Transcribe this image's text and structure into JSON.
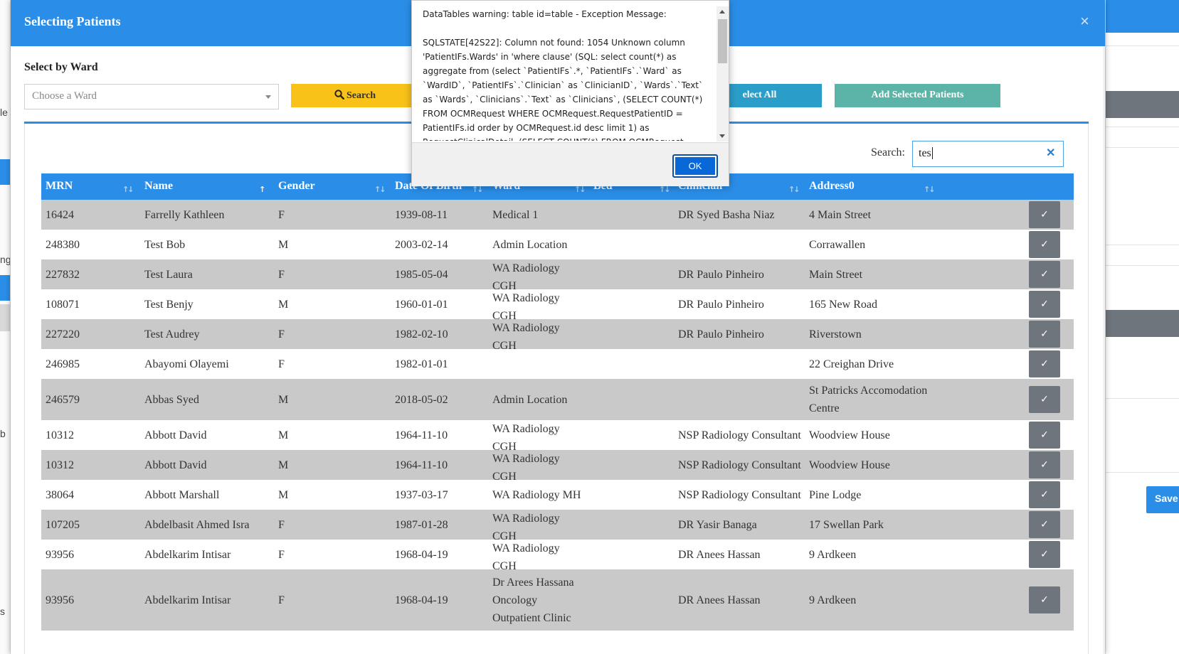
{
  "background": {
    "left_fragments": [
      "le",
      "ng",
      "b",
      "s"
    ],
    "save_label": "Save"
  },
  "modal": {
    "title": "Selecting Patients",
    "close_glyph": "×",
    "ward_label": "Select by Ward",
    "ward_placeholder": "Choose a Ward",
    "search_button": "Search",
    "select_all_button": "elect All",
    "add_selected_button": "Add Selected Patients",
    "search_label": "Search:",
    "search_value": "tes",
    "clear_glyph": "✕"
  },
  "table": {
    "columns": [
      "MRN",
      "Name",
      "Gender",
      "Date Of Birth",
      "Ward",
      "Bed",
      "Clinician",
      "Address0"
    ],
    "rows": [
      {
        "mrn": "16424",
        "name": "Farrelly Kathleen",
        "gender": "F",
        "dob": "1939-08-11",
        "ward": "Medical 1",
        "clinician": "DR Syed Basha Niaz",
        "address": "4 Main Street"
      },
      {
        "mrn": "248380",
        "name": "Test Bob",
        "gender": "M",
        "dob": "2003-02-14",
        "ward": "Admin Location",
        "clinician": "",
        "address": "Corrawallen"
      },
      {
        "mrn": "227832",
        "name": "Test Laura",
        "gender": "F",
        "dob": "1985-05-04",
        "ward": "WA Radiology CGH",
        "clinician": "DR Paulo Pinheiro",
        "address": "Main Street"
      },
      {
        "mrn": "108071",
        "name": "Test Benjy",
        "gender": "M",
        "dob": "1960-01-01",
        "ward": "WA Radiology CGH",
        "clinician": "DR Paulo Pinheiro",
        "address": "165 New Road"
      },
      {
        "mrn": "227220",
        "name": "Test Audrey",
        "gender": "F",
        "dob": "1982-02-10",
        "ward": "WA Radiology CGH",
        "clinician": "DR Paulo Pinheiro",
        "address": "Riverstown"
      },
      {
        "mrn": "246985",
        "name": "Abayomi Olayemi",
        "gender": "F",
        "dob": "1982-01-01",
        "ward": "",
        "clinician": "",
        "address": "22 Creighan Drive"
      },
      {
        "mrn": "246579",
        "name": "Abbas Syed",
        "gender": "M",
        "dob": "2018-05-02",
        "ward": "Admin Location",
        "clinician": "",
        "address": "St Patricks Accomodation Centre"
      },
      {
        "mrn": "10312",
        "name": "Abbott David",
        "gender": "M",
        "dob": "1964-11-10",
        "ward": "WA Radiology CGH",
        "clinician": "NSP Radiology Consultant",
        "address": "Woodview House"
      },
      {
        "mrn": "10312",
        "name": "Abbott David",
        "gender": "M",
        "dob": "1964-11-10",
        "ward": "WA Radiology CGH",
        "clinician": "NSP Radiology Consultant",
        "address": "Woodview House"
      },
      {
        "mrn": "38064",
        "name": "Abbott Marshall",
        "gender": "M",
        "dob": "1937-03-17",
        "ward": "WA Radiology MH",
        "clinician": "NSP Radiology Consultant",
        "address": "Pine Lodge"
      },
      {
        "mrn": "107205",
        "name": "Abdelbasit Ahmed Isra",
        "gender": "F",
        "dob": "1987-01-28",
        "ward": "WA Radiology CGH",
        "clinician": "DR Yasir Banaga",
        "address": "17 Swellan Park"
      },
      {
        "mrn": "93956",
        "name": "Abdelkarim Intisar",
        "gender": "F",
        "dob": "1968-04-19",
        "ward": "WA Radiology CGH",
        "clinician": "DR Anees Hassan",
        "address": "9 Ardkeen"
      },
      {
        "mrn": "93956",
        "name": "Abdelkarim Intisar",
        "gender": "F",
        "dob": "1968-04-19",
        "ward": "Dr Arees Hassana Oncology Outpatient Clinic",
        "clinician": "DR Anees Hassan",
        "address": "9 Ardkeen"
      }
    ],
    "select_glyph": "✓"
  },
  "alert": {
    "message": "DataTables warning: table id=table - Exception Message:\n\nSQLSTATE[42S22]: Column not found: 1054 Unknown column 'PatientIFs.Wards' in 'where clause' (SQL: select count(*) as aggregate from (select `PatientIFs`.*, `PatientIFs`.`Ward` as `WardID`, `PatientIFs`.`Clinician` as `ClinicianID`, `Wards`.`Text` as `Wards`, `Clinicians`.`Text` as `Clinicians`, (SELECT COUNT(*) FROM OCMRequest WHERE OCMRequest.RequestPatientID = PatientIFs.id order by OCMRequest.id desc limit 1) as RequestClinicalDetail, (SELECT COUNT(*) FROM OCMRequest WHERE",
    "ok_label": "OK"
  },
  "colors": {
    "header_blue": "#2a8ee8",
    "search_yellow": "#f8c218",
    "select_all_teal": "#2a9ec9",
    "add_selected_green": "#5cb3a8",
    "row_grey": "#c9c9c9",
    "check_button": "#6e757c"
  }
}
